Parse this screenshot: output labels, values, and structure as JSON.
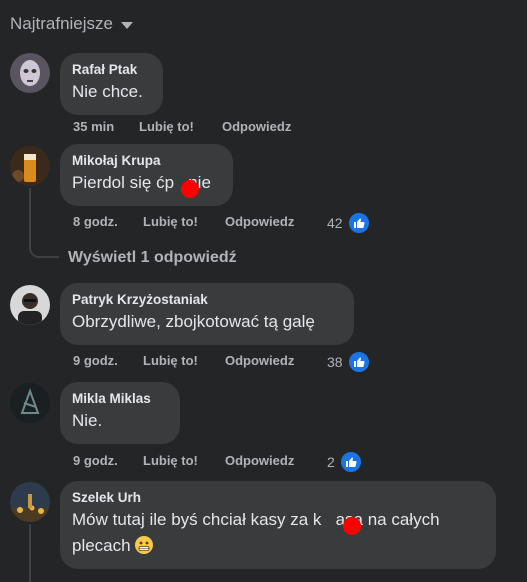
{
  "sort": {
    "label": "Najtrafniejsze"
  },
  "view_replies": "Wyświetl 1 odpowiedź",
  "comments": [
    {
      "author": "Rafał Ptak",
      "text": "Nie chce.",
      "time": "35 min",
      "like": "Lubię to!",
      "reply": "Odpowiedz",
      "reactions": ""
    },
    {
      "author": "Mikołaj Krupa",
      "text": "Pierdol się ćp   nie",
      "time": "8 godz.",
      "like": "Lubię to!",
      "reply": "Odpowiedz",
      "reactions": "42"
    },
    {
      "author": "Patryk Krzyżostaniak",
      "text": "Obrzydliwe, zbojkotować tą galę",
      "time": "9 godz.",
      "like": "Lubię to!",
      "reply": "Odpowiedz",
      "reactions": "38"
    },
    {
      "author": "Mikla Miklas",
      "text": "Nie.",
      "time": "9 godz.",
      "like": "Lubię to!",
      "reply": "Odpowiedz",
      "reactions": "2"
    },
    {
      "author": "Szelek Urh",
      "text_line1": "Mów tutaj ile byś chciał kasy za k   asa na całych",
      "text_line2": "plecach"
    }
  ],
  "colors": {
    "bg": "#242526",
    "bubble": "#3a3b3c",
    "like_blue": "#1b74e4",
    "redact": "#ff0000"
  }
}
